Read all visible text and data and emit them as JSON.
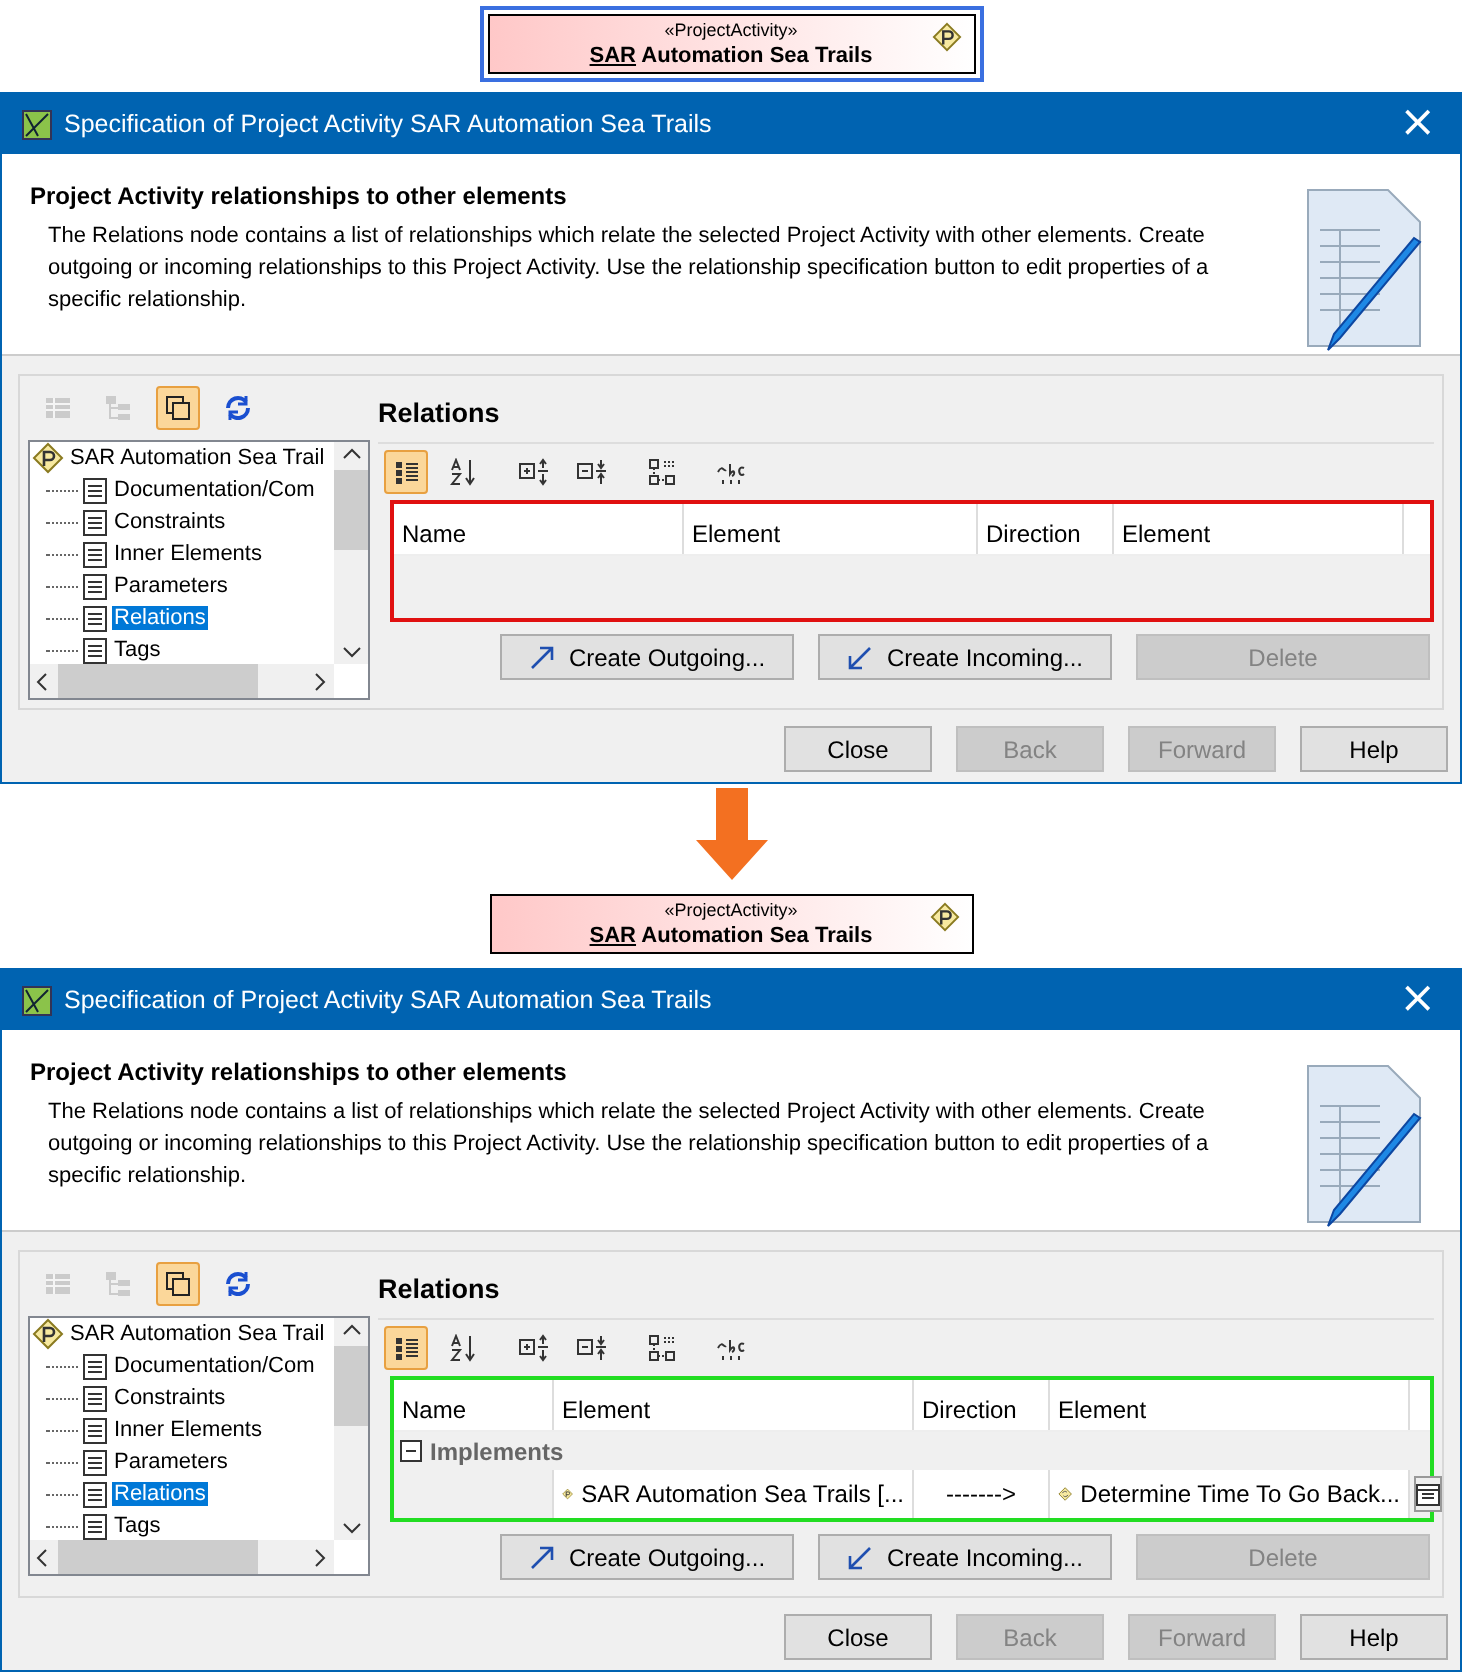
{
  "steps": [
    {
      "element": {
        "stereotype": "«ProjectActivity»",
        "name_underlined": "SAR",
        "name": "Automation Sea Trails",
        "selected": true
      },
      "dialog": {
        "title": "Specification of Project Activity SAR Automation Sea Trails",
        "close": "×",
        "heading": "Project Activity relationships to other elements",
        "description": "The Relations node contains a list of relationships which relate the selected Project Activity with other elements. Create outgoing or incoming relationships to this Project Activity. Use the relationship specification button to edit properties of a specific relationship.",
        "toolbar": [
          {
            "kind": "table",
            "disabled": true,
            "selected": false
          },
          {
            "kind": "tree",
            "disabled": true,
            "selected": false
          },
          {
            "kind": "copy",
            "disabled": false,
            "selected": true
          },
          {
            "kind": "refresh",
            "disabled": false,
            "selected": false
          }
        ],
        "tree": {
          "root": "SAR Automation Sea Trail",
          "items": [
            {
              "label": "Documentation/Com",
              "selected": false
            },
            {
              "label": "Constraints",
              "selected": false
            },
            {
              "label": "Inner Elements",
              "selected": false
            },
            {
              "label": "Parameters",
              "selected": false
            },
            {
              "label": "Relations",
              "selected": true
            },
            {
              "label": "Tags",
              "selected": false
            }
          ]
        },
        "section_title": "Relations",
        "table_toolbar": [
          {
            "kind": "categorized",
            "selected": true
          },
          {
            "kind": "sort",
            "selected": false
          },
          {
            "kind": "expand",
            "selected": false
          },
          {
            "kind": "collapse",
            "selected": false
          },
          {
            "kind": "hierarchy",
            "selected": false
          },
          {
            "kind": "text",
            "selected": false
          }
        ],
        "columns": [
          "Name",
          "Element",
          "Direction",
          "Element"
        ],
        "highlight": {
          "color": "#e01010"
        },
        "actions": [
          {
            "label": "Create Outgoing...",
            "kind": "outgoing",
            "disabled": false
          },
          {
            "label": "Create Incoming...",
            "kind": "incoming",
            "disabled": false
          },
          {
            "label": "Delete",
            "kind": "plain",
            "disabled": true
          }
        ],
        "buttons": [
          {
            "label": "Close",
            "disabled": false
          },
          {
            "label": "Back",
            "disabled": true
          },
          {
            "label": "Forward",
            "disabled": true
          },
          {
            "label": "Help",
            "disabled": false
          }
        ]
      }
    },
    {
      "element": {
        "stereotype": "«ProjectActivity»",
        "name_underlined": "SAR",
        "name": "Automation Sea Trails",
        "selected": false
      },
      "dialog": {
        "title": "Specification of Project Activity SAR Automation Sea Trails",
        "close": "×",
        "heading": "Project Activity relationships to other elements",
        "description": "The Relations node contains a list of relationships which relate the selected Project Activity with other elements. Create outgoing or incoming relationships to this Project Activity. Use the relationship specification button to edit properties of a specific relationship.",
        "toolbar": [
          {
            "kind": "table",
            "disabled": true,
            "selected": false
          },
          {
            "kind": "tree",
            "disabled": true,
            "selected": false
          },
          {
            "kind": "copy",
            "disabled": false,
            "selected": true
          },
          {
            "kind": "refresh",
            "disabled": false,
            "selected": false
          }
        ],
        "tree": {
          "root": "SAR Automation Sea Trail",
          "items": [
            {
              "label": "Documentation/Com",
              "selected": false
            },
            {
              "label": "Constraints",
              "selected": false
            },
            {
              "label": "Inner Elements",
              "selected": false
            },
            {
              "label": "Parameters",
              "selected": false
            },
            {
              "label": "Relations",
              "selected": true
            },
            {
              "label": "Tags",
              "selected": false
            }
          ]
        },
        "section_title": "Relations",
        "table_toolbar": [
          {
            "kind": "categorized",
            "selected": true
          },
          {
            "kind": "sort",
            "selected": false
          },
          {
            "kind": "expand",
            "selected": false
          },
          {
            "kind": "collapse",
            "selected": false
          },
          {
            "kind": "hierarchy",
            "selected": false
          },
          {
            "kind": "text",
            "selected": false
          }
        ],
        "columns": [
          "Name",
          "Element",
          "Direction",
          "Element"
        ],
        "groups": [
          {
            "label": "Implements",
            "expanded": true,
            "rows": [
              {
                "element": "SAR Automation Sea Trails [...",
                "direction": "------->",
                "target": "Determine Time To Go Back..."
              }
            ]
          }
        ],
        "highlight": {
          "color": "#22dd22"
        },
        "actions": [
          {
            "label": "Create Outgoing...",
            "kind": "outgoing",
            "disabled": false
          },
          {
            "label": "Create Incoming...",
            "kind": "incoming",
            "disabled": false
          },
          {
            "label": "Delete",
            "kind": "plain",
            "disabled": true
          }
        ],
        "buttons": [
          {
            "label": "Close",
            "disabled": false
          },
          {
            "label": "Back",
            "disabled": true
          },
          {
            "label": "Forward",
            "disabled": true
          },
          {
            "label": "Help",
            "disabled": false
          }
        ]
      }
    }
  ]
}
